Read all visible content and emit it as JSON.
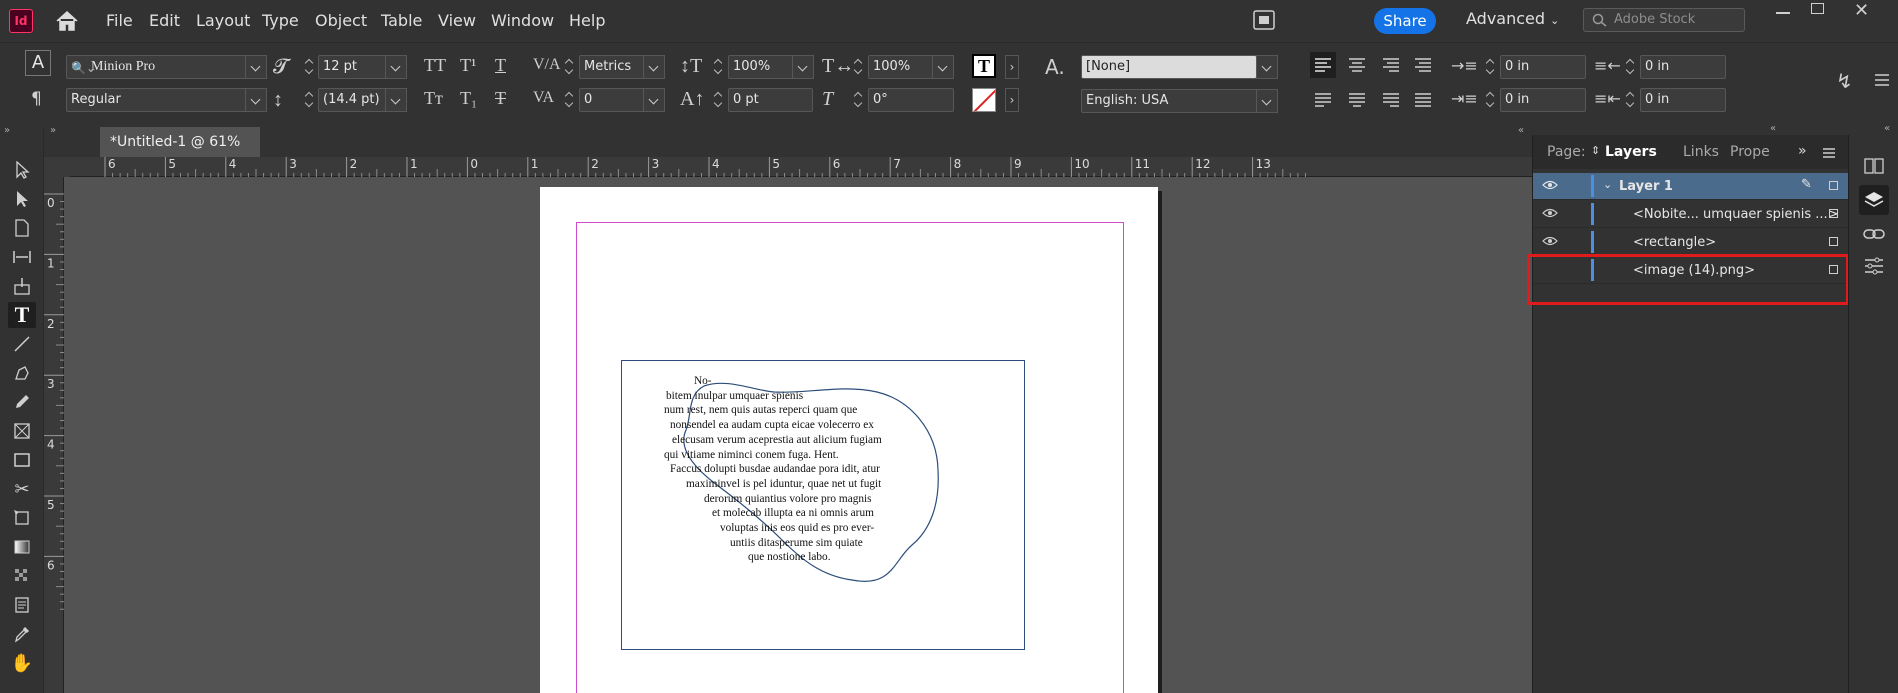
{
  "app": {
    "logo": "Id"
  },
  "menu": [
    "File",
    "Edit",
    "Layout",
    "Type",
    "Object",
    "Table",
    "View",
    "Window",
    "Help"
  ],
  "header": {
    "share_label": "Share",
    "workspace": "Advanced",
    "stock_placeholder": "Adobe Stock"
  },
  "control": {
    "font_family": "Minion Pro",
    "font_style": "Regular",
    "font_size": "12 pt",
    "leading": "(14.4 pt)",
    "kerning": "Metrics",
    "tracking": "0",
    "vertical_scale": "100%",
    "horizontal_scale": "100%",
    "baseline_shift": "0 pt",
    "skew": "0°",
    "char_style": "[None]",
    "language": "English: USA",
    "left_indent": "0 in",
    "right_indent": "0 in",
    "first_line_indent": "0 in",
    "last_line_indent": "0 in"
  },
  "document": {
    "tab_title": "*Untitled-1 @ 61%"
  },
  "rulers": {
    "horizontal": [
      "6",
      "5",
      "4",
      "3",
      "2",
      "1",
      "0",
      "1",
      "2",
      "3",
      "4",
      "5",
      "6",
      "7",
      "8",
      "9",
      "10",
      "11",
      "12",
      "13"
    ],
    "vertical": [
      "0",
      "1",
      "2",
      "3",
      "4",
      "5",
      "6"
    ]
  },
  "story_lines": [
    "No-",
    "bitem inulpar umquaer spienis",
    "num rest, nem quis autas reperci quam que",
    "nonsendel ea audam cupta eicae volecerro ex",
    "elecusam verum aceprestia aut alicium fugiam",
    "qui vitiame niminci conem fuga. Hent.",
    "Faccus dolupti busdae audandae pora idit, atur",
    "maximinvel is pel iduntur, quae net ut fugit",
    "derorum quiantius volore pro magnis",
    "et molecab illupta ea ni omnis arum",
    "voluptas inis eos quid es pro ever-",
    "untiis ditasperume sim quiate",
    "que nostione labo."
  ],
  "panel": {
    "tabs": [
      "Page:",
      "Layers",
      "Links",
      "Prope"
    ],
    "layers": [
      {
        "name": "Layer 1",
        "visible": true
      },
      {
        "name": "<Nobite... umquaer spienis ...>",
        "visible": true
      },
      {
        "name": "<rectangle>",
        "visible": true
      },
      {
        "name": "<image (14).png>",
        "visible": false
      }
    ]
  },
  "colors": {
    "accent": "#1473e6",
    "highlight": "#e01b1b",
    "layer_color": "#4a90e2",
    "margin_guide": "#d14bd1"
  }
}
